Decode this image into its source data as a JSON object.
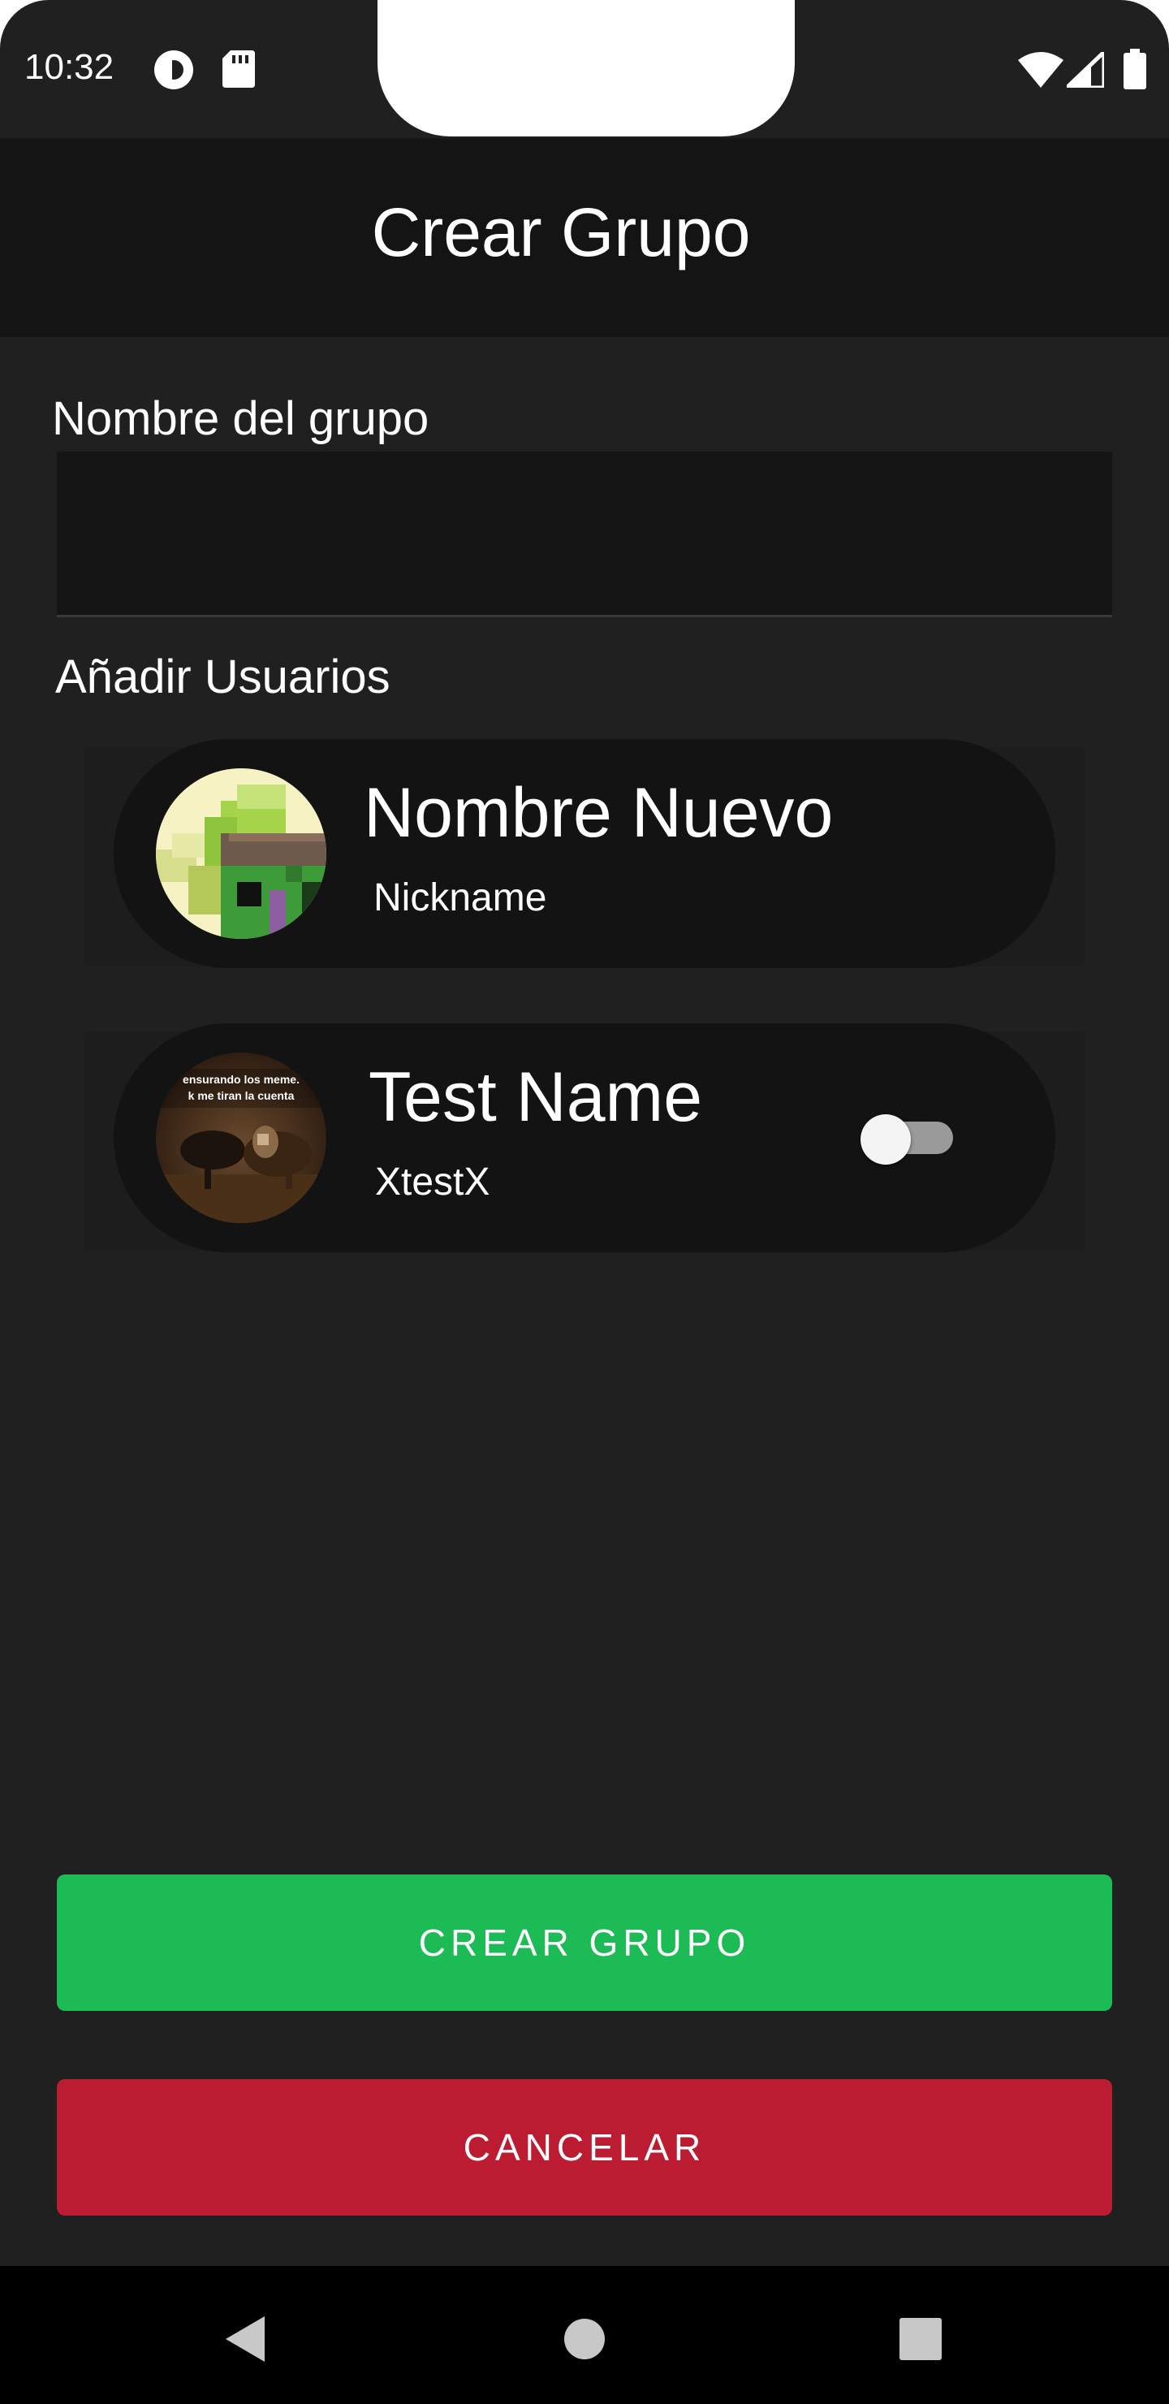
{
  "status_bar": {
    "time": "10:32",
    "icons": [
      "pocket-casts-icon",
      "sd-card-icon",
      "wifi-icon",
      "cell-signal-icon",
      "battery-icon"
    ]
  },
  "app_bar": {
    "title": "Crear Grupo"
  },
  "form": {
    "group_name_label": "Nombre del grupo",
    "group_name_value": "",
    "add_users_label": "Añadir Usuarios"
  },
  "users": [
    {
      "name": "Nombre Nuevo",
      "nickname": "Nickname",
      "avatar": "pixel-art-avatar",
      "has_toggle": false
    },
    {
      "name": "Test Name",
      "nickname": "XtestX",
      "avatar": "dog-photo-avatar",
      "has_toggle": true,
      "toggle_on": false,
      "avatar_caption": "ensurando los meme. k me tiran la cuenta"
    }
  ],
  "buttons": {
    "create_label": "CREAR GRUPO",
    "cancel_label": "CANCELAR"
  },
  "nav_bar": {
    "icons": [
      "back-icon",
      "home-icon",
      "recents-icon"
    ]
  },
  "colors": {
    "background": "#202020",
    "app_bar": "#141414",
    "card": "#131313",
    "create_button": "#1dbb55",
    "cancel_button": "#bc1c31"
  }
}
